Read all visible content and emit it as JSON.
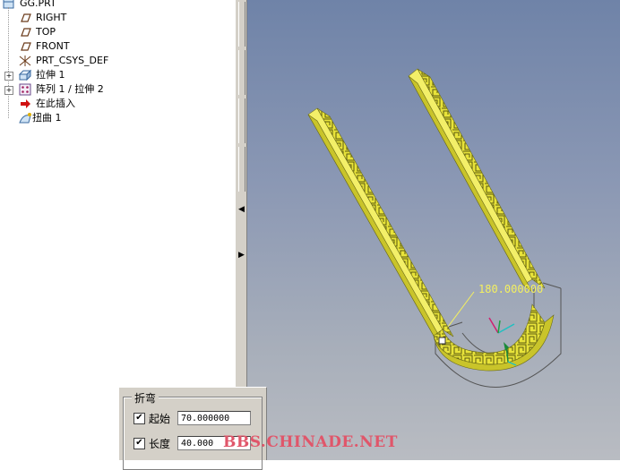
{
  "model_tree": {
    "root": {
      "label": "GG.PRT",
      "icon": "part-icon"
    },
    "items": [
      {
        "label": "RIGHT",
        "icon": "datum-plane-icon",
        "expandable": false
      },
      {
        "label": "TOP",
        "icon": "datum-plane-icon",
        "expandable": false
      },
      {
        "label": "FRONT",
        "icon": "datum-plane-icon",
        "expandable": false
      },
      {
        "label": "PRT_CSYS_DEF",
        "icon": "csys-icon",
        "expandable": false
      },
      {
        "label": "拉伸 1",
        "icon": "extrude-icon",
        "expandable": true
      },
      {
        "label": "阵列 1 / 拉伸 2",
        "icon": "pattern-icon",
        "expandable": true
      },
      {
        "label": "在此插入",
        "icon": "insert-here-arrow-icon",
        "expandable": false
      },
      {
        "label": "扭曲 1",
        "icon": "warp-icon",
        "expandable": false
      }
    ]
  },
  "viewport": {
    "dimension_label": "180.000000",
    "colors": {
      "model": "#e8e33a",
      "dimension": "#f4f060",
      "background_top": "#6f83a8"
    }
  },
  "bend_panel": {
    "title": "折弯",
    "start": {
      "label": "起始",
      "value": "70.000000",
      "checked": true
    },
    "length": {
      "label": "长度",
      "value": "40.000",
      "checked": true
    }
  },
  "watermark": "BBS.CHINADE.NET"
}
